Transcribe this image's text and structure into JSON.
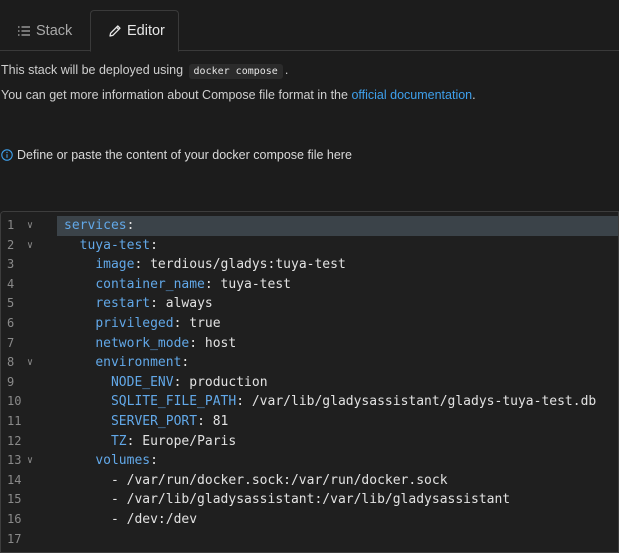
{
  "tabs": {
    "stack_label": "Stack",
    "editor_label": "Editor"
  },
  "intro": {
    "deploy_prefix": "This stack will be deployed using",
    "deploy_code": "docker compose",
    "deploy_suffix": ".",
    "info_prefix": "You can get more information about Compose file format in the",
    "info_link": "official documentation",
    "info_suffix": "."
  },
  "hint": {
    "text": "Define or paste the content of your docker compose file here"
  },
  "colors": {
    "key": "#62a8e8",
    "link": "#3ea0ec",
    "background": "#1c1c1c",
    "active_line": "#3b4349"
  },
  "editor": {
    "lines": [
      {
        "num": "1",
        "fold": true,
        "indent": "",
        "key": "services",
        "sep": ":",
        "val": ""
      },
      {
        "num": "2",
        "fold": true,
        "indent": "  ",
        "key": "tuya-test",
        "sep": ":",
        "val": ""
      },
      {
        "num": "3",
        "fold": false,
        "indent": "    ",
        "key": "image",
        "sep": ": ",
        "val": "terdious/gladys:tuya-test"
      },
      {
        "num": "4",
        "fold": false,
        "indent": "    ",
        "key": "container_name",
        "sep": ": ",
        "val": "tuya-test"
      },
      {
        "num": "5",
        "fold": false,
        "indent": "    ",
        "key": "restart",
        "sep": ": ",
        "val": "always"
      },
      {
        "num": "6",
        "fold": false,
        "indent": "    ",
        "key": "privileged",
        "sep": ": ",
        "val": "true"
      },
      {
        "num": "7",
        "fold": false,
        "indent": "    ",
        "key": "network_mode",
        "sep": ": ",
        "val": "host"
      },
      {
        "num": "8",
        "fold": true,
        "indent": "    ",
        "key": "environment",
        "sep": ":",
        "val": ""
      },
      {
        "num": "9",
        "fold": false,
        "indent": "      ",
        "key": "NODE_ENV",
        "sep": ": ",
        "val": "production"
      },
      {
        "num": "10",
        "fold": false,
        "indent": "      ",
        "key": "SQLITE_FILE_PATH",
        "sep": ": ",
        "val": "/var/lib/gladysassistant/gladys-tuya-test.db"
      },
      {
        "num": "11",
        "fold": false,
        "indent": "      ",
        "key": "SERVER_PORT",
        "sep": ": ",
        "val": "81"
      },
      {
        "num": "12",
        "fold": false,
        "indent": "      ",
        "key": "TZ",
        "sep": ": ",
        "val": "Europe/Paris"
      },
      {
        "num": "13",
        "fold": true,
        "indent": "    ",
        "key": "volumes",
        "sep": ":",
        "val": ""
      },
      {
        "num": "14",
        "fold": false,
        "indent": "      ",
        "key": "",
        "sep": "",
        "val": "- /var/run/docker.sock:/var/run/docker.sock"
      },
      {
        "num": "15",
        "fold": false,
        "indent": "      ",
        "key": "",
        "sep": "",
        "val": "- /var/lib/gladysassistant:/var/lib/gladysassistant"
      },
      {
        "num": "16",
        "fold": false,
        "indent": "      ",
        "key": "",
        "sep": "",
        "val": "- /dev:/dev"
      },
      {
        "num": "17",
        "fold": false,
        "indent": "",
        "key": "",
        "sep": "",
        "val": ""
      }
    ]
  }
}
